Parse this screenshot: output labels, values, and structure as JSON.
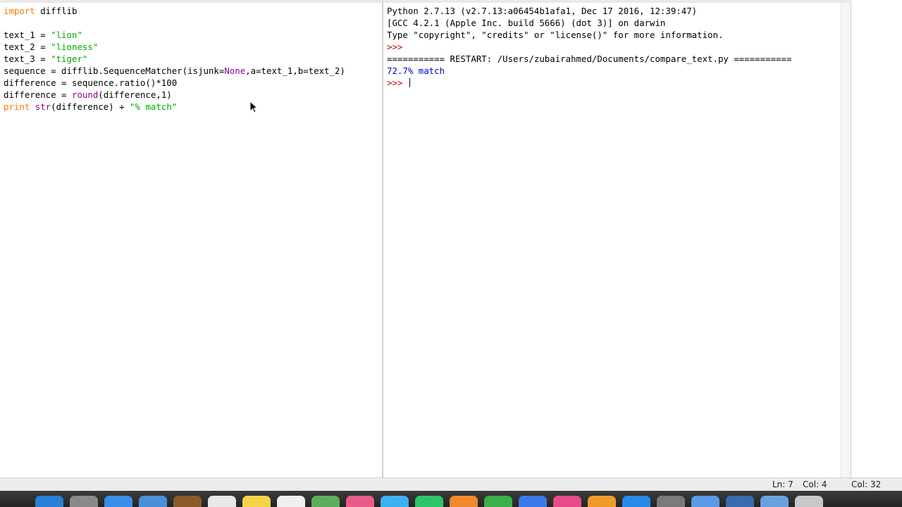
{
  "editor": {
    "lines": [
      {
        "parts": [
          {
            "t": "import",
            "c": "kw"
          },
          {
            "t": " difflib",
            "c": ""
          }
        ]
      },
      {
        "parts": [
          {
            "t": "",
            "c": ""
          }
        ]
      },
      {
        "parts": [
          {
            "t": "text_1 = ",
            "c": ""
          },
          {
            "t": "\"lion\"",
            "c": "str"
          }
        ]
      },
      {
        "parts": [
          {
            "t": "text_2 = ",
            "c": ""
          },
          {
            "t": "\"lioness\"",
            "c": "str"
          }
        ]
      },
      {
        "parts": [
          {
            "t": "text_3 = ",
            "c": ""
          },
          {
            "t": "\"tiger\"",
            "c": "str"
          }
        ]
      },
      {
        "parts": [
          {
            "t": "sequence = difflib.SequenceMatcher(isjunk=",
            "c": ""
          },
          {
            "t": "None",
            "c": "builtin"
          },
          {
            "t": ",a=text_1,b=text_2)",
            "c": ""
          }
        ]
      },
      {
        "parts": [
          {
            "t": "difference = sequence.ratio()*100",
            "c": ""
          }
        ]
      },
      {
        "parts": [
          {
            "t": "difference = ",
            "c": ""
          },
          {
            "t": "round",
            "c": "builtin"
          },
          {
            "t": "(difference,1)",
            "c": ""
          }
        ]
      },
      {
        "parts": [
          {
            "t": "print",
            "c": "kw"
          },
          {
            "t": " ",
            "c": ""
          },
          {
            "t": "str",
            "c": "builtin"
          },
          {
            "t": "(difference) + ",
            "c": ""
          },
          {
            "t": "\"% match\"",
            "c": "str"
          }
        ]
      }
    ]
  },
  "shell": {
    "lines": [
      {
        "parts": [
          {
            "t": "Python 2.7.13 (v2.7.13:a06454b1afa1, Dec 17 2016, 12:39:47)",
            "c": ""
          }
        ]
      },
      {
        "parts": [
          {
            "t": "[GCC 4.2.1 (Apple Inc. build 5666) (dot 3)] on darwin",
            "c": ""
          }
        ]
      },
      {
        "parts": [
          {
            "t": "Type \"copyright\", \"credits\" or \"license()\" for more information.",
            "c": ""
          }
        ]
      },
      {
        "parts": [
          {
            "t": ">>> ",
            "c": "prompt"
          }
        ]
      },
      {
        "parts": [
          {
            "t": "=========== RESTART: /Users/zubairahmed/Documents/compare_text.py ===========",
            "c": ""
          }
        ]
      },
      {
        "parts": [
          {
            "t": "72.7% match",
            "c": "stdout"
          }
        ]
      },
      {
        "parts": [
          {
            "t": ">>> ",
            "c": "prompt"
          }
        ],
        "caret": true
      }
    ]
  },
  "status": {
    "ln": "Ln: 7",
    "col": "Col: 4",
    "other_col": "Col: 32"
  },
  "dock": {
    "icons": [
      "finder-icon",
      "launchpad-icon",
      "safari-icon",
      "mail-icon",
      "contacts-icon",
      "calendar-icon",
      "notes-icon",
      "reminders-icon",
      "maps-icon",
      "photos-icon",
      "messages-icon",
      "facetime-icon",
      "pages-icon",
      "numbers-icon",
      "keynote-icon",
      "itunes-icon",
      "ibooks-icon",
      "app-store-icon",
      "system-preferences-icon",
      "preview-icon",
      "python-icon",
      "folder-icon",
      "trash-icon"
    ],
    "colors": [
      "#2a7fd6",
      "#8a8a8a",
      "#3a8ee8",
      "#4a90d9",
      "#8b5a2b",
      "#e8e8e8",
      "#f5d547",
      "#f0f0f0",
      "#5cae5c",
      "#e85c8a",
      "#3cb0f0",
      "#2ec46a",
      "#f08a2a",
      "#3cb04a",
      "#3a7ae8",
      "#e84a8a",
      "#f09a2a",
      "#2a8ae8",
      "#7a7a7a",
      "#5a9ae8",
      "#3a6ab0",
      "#6aa0e0",
      "#c8c8c8"
    ]
  }
}
